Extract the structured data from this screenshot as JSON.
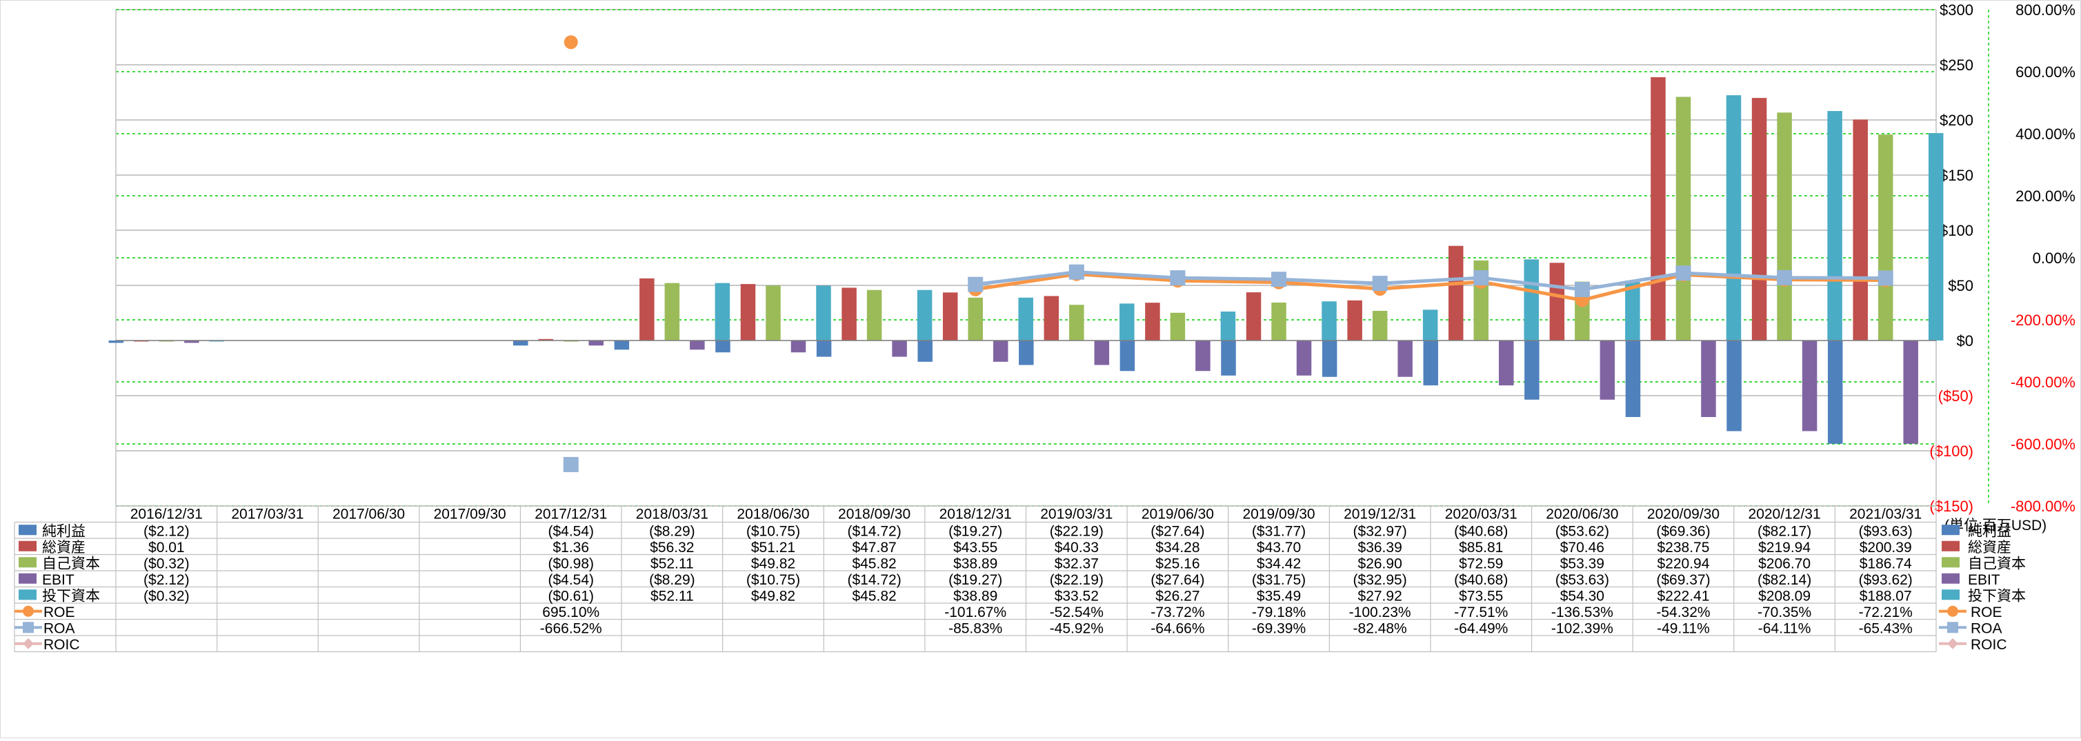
{
  "chart_data": {
    "type": "bar",
    "categories": [
      "2016/12/31",
      "2017/03/31",
      "2017/06/30",
      "2017/09/30",
      "2017/12/31",
      "2018/03/31",
      "2018/06/30",
      "2018/09/30",
      "2018/12/31",
      "2019/03/31",
      "2019/06/30",
      "2019/09/30",
      "2019/12/31",
      "2020/03/31",
      "2020/06/30",
      "2020/09/30",
      "2020/12/31",
      "2021/03/31"
    ],
    "series": [
      {
        "name": "純利益",
        "kind": "bar",
        "color": "#4f81bd",
        "values": [
          -2.12,
          null,
          null,
          null,
          -4.54,
          -8.29,
          -10.75,
          -14.72,
          -19.27,
          -22.19,
          -27.64,
          -31.77,
          -32.97,
          -40.68,
          -53.62,
          -69.36,
          -82.17,
          -93.63
        ],
        "labels": [
          "($2.12)",
          "",
          "",
          "",
          "($4.54)",
          "($8.29)",
          "($10.75)",
          "($14.72)",
          "($19.27)",
          "($22.19)",
          "($27.64)",
          "($31.77)",
          "($32.97)",
          "($40.68)",
          "($53.62)",
          "($69.36)",
          "($82.17)",
          "($93.63)"
        ]
      },
      {
        "name": "総資産",
        "kind": "bar",
        "color": "#c0504d",
        "values": [
          0.01,
          null,
          null,
          null,
          1.36,
          56.32,
          51.21,
          47.87,
          43.55,
          40.33,
          34.28,
          43.7,
          36.39,
          85.81,
          70.46,
          238.75,
          219.94,
          200.39
        ],
        "labels": [
          "$0.01",
          "",
          "",
          "",
          "$1.36",
          "$56.32",
          "$51.21",
          "$47.87",
          "$43.55",
          "$40.33",
          "$34.28",
          "$43.70",
          "$36.39",
          "$85.81",
          "$70.46",
          "$238.75",
          "$219.94",
          "$200.39"
        ]
      },
      {
        "name": "自己資本",
        "kind": "bar",
        "color": "#9bbb59",
        "values": [
          -0.32,
          null,
          null,
          null,
          -0.98,
          52.11,
          49.82,
          45.82,
          38.89,
          32.37,
          25.16,
          34.42,
          26.9,
          72.59,
          53.39,
          220.94,
          206.7,
          186.74
        ],
        "labels": [
          "($0.32)",
          "",
          "",
          "",
          "($0.98)",
          "$52.11",
          "$49.82",
          "$45.82",
          "$38.89",
          "$32.37",
          "$25.16",
          "$34.42",
          "$26.90",
          "$72.59",
          "$53.39",
          "$220.94",
          "$206.70",
          "$186.74"
        ]
      },
      {
        "name": "EBIT",
        "kind": "bar",
        "color": "#8064a2",
        "values": [
          -2.12,
          null,
          null,
          null,
          -4.54,
          -8.29,
          -10.75,
          -14.72,
          -19.27,
          -22.19,
          -27.64,
          -31.75,
          -32.95,
          -40.68,
          -53.63,
          -69.37,
          -82.14,
          -93.62
        ],
        "labels": [
          "($2.12)",
          "",
          "",
          "",
          "($4.54)",
          "($8.29)",
          "($10.75)",
          "($14.72)",
          "($19.27)",
          "($22.19)",
          "($27.64)",
          "($31.75)",
          "($32.95)",
          "($40.68)",
          "($53.63)",
          "($69.37)",
          "($82.14)",
          "($93.62)"
        ]
      },
      {
        "name": "投下資本",
        "kind": "bar",
        "color": "#4bacc6",
        "values": [
          -0.32,
          null,
          null,
          null,
          -0.61,
          52.11,
          49.82,
          45.82,
          38.89,
          33.52,
          26.27,
          35.49,
          27.92,
          73.55,
          54.3,
          222.41,
          208.09,
          188.07
        ],
        "labels": [
          "($0.32)",
          "",
          "",
          "",
          "($0.61)",
          "$52.11",
          "$49.82",
          "$45.82",
          "$38.89",
          "$33.52",
          "$26.27",
          "$35.49",
          "$27.92",
          "$73.55",
          "$54.30",
          "$222.41",
          "$208.09",
          "$188.07"
        ]
      },
      {
        "name": "ROE",
        "kind": "line",
        "axis": "right",
        "color": "#f79646",
        "marker": "circle",
        "values": [
          null,
          null,
          null,
          null,
          695.1,
          null,
          null,
          null,
          -101.67,
          -52.54,
          -73.72,
          -79.18,
          -100.23,
          -77.51,
          -136.53,
          -54.32,
          -70.35,
          -72.21
        ],
        "labels": [
          "",
          "",
          "",
          "",
          "695.10%",
          "",
          "",
          "",
          "-101.67%",
          "-52.54%",
          "-73.72%",
          "-79.18%",
          "-100.23%",
          "-77.51%",
          "-136.53%",
          "-54.32%",
          "-70.35%",
          "-72.21%"
        ]
      },
      {
        "name": "ROA",
        "kind": "line",
        "axis": "right",
        "color": "#95b3d7",
        "marker": "square",
        "values": [
          null,
          null,
          null,
          null,
          -666.52,
          null,
          null,
          null,
          -85.83,
          -45.92,
          -64.66,
          -69.39,
          -82.48,
          -64.49,
          -102.39,
          -49.11,
          -64.11,
          -65.43
        ],
        "labels": [
          "",
          "",
          "",
          "",
          "-666.52%",
          "",
          "",
          "",
          "-85.83%",
          "-45.92%",
          "-64.66%",
          "-69.39%",
          "-82.48%",
          "-64.49%",
          "-102.39%",
          "-49.11%",
          "-64.11%",
          "-65.43%"
        ]
      },
      {
        "name": "ROIC",
        "kind": "line",
        "axis": "right",
        "color": "#e6b9b8",
        "marker": "diamond",
        "values": [
          null,
          null,
          null,
          null,
          null,
          null,
          null,
          null,
          null,
          null,
          null,
          null,
          null,
          null,
          null,
          null,
          null,
          null
        ],
        "labels": [
          "",
          "",
          "",
          "",
          "",
          "",
          "",
          "",
          "",
          "",
          "",
          "",
          "",
          "",
          "",
          "",
          "",
          ""
        ]
      }
    ],
    "left_axis": {
      "ylim": [
        -150,
        300
      ],
      "ticks": [
        300,
        250,
        200,
        150,
        100,
        50,
        0,
        -50,
        -100,
        -150
      ],
      "tick_labels": [
        "$300",
        "$250",
        "$200",
        "$150",
        "$100",
        "$50",
        "$0",
        "($50)",
        "($100)",
        "($150)"
      ]
    },
    "right_axis": {
      "ylim": [
        -800,
        800
      ],
      "ticks": [
        800,
        600,
        400,
        200,
        0,
        -200,
        -400,
        -600,
        -800
      ],
      "tick_labels": [
        "800.00%",
        "600.00%",
        "400.00%",
        "200.00%",
        "0.00%",
        "-200.00%",
        "-400.00%",
        "-600.00%",
        "-800.00%"
      ]
    },
    "unit_note": "(単位:百万USD)",
    "grid": true,
    "data_table": true,
    "colors": {
      "negative_label": "#ff0000",
      "gridline": "#a6a6a6",
      "right_gridline": "#00cc00"
    }
  }
}
